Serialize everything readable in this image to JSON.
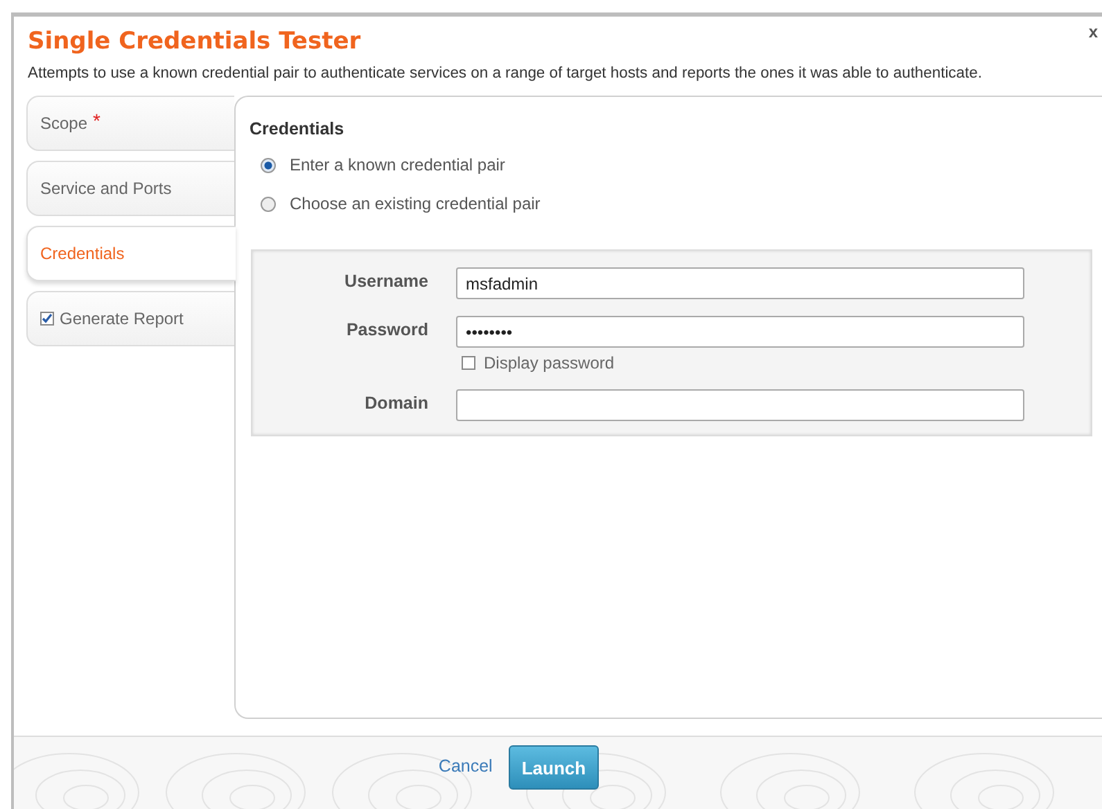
{
  "dialog": {
    "title": "Single Credentials Tester",
    "close": "x",
    "description": "Attempts to use a known credential pair to authenticate services on a range of target hosts and reports the ones it was able to authenticate."
  },
  "tabs": [
    {
      "kind": "required",
      "label": "Scope",
      "marker": "*",
      "selected": false
    },
    {
      "kind": "plain",
      "label": "Service and Ports",
      "selected": false
    },
    {
      "kind": "plain",
      "label": "Credentials",
      "selected": true
    },
    {
      "kind": "checkbox",
      "label": "Generate Report",
      "checked": true,
      "selected": false
    }
  ],
  "panel": {
    "heading": "Credentials",
    "options": [
      {
        "label": "Enter a known credential pair",
        "selected": true
      },
      {
        "label": "Choose an existing credential pair",
        "selected": false
      }
    ],
    "fields": [
      {
        "label": "Username",
        "value": "msfadmin"
      },
      {
        "label": "Password",
        "value": "••••••••",
        "toggle": {
          "label": "Display password",
          "checked": false
        }
      },
      {
        "label": "Domain"
      }
    ]
  },
  "footer": {
    "cancel": "Cancel",
    "launch": "Launch"
  }
}
